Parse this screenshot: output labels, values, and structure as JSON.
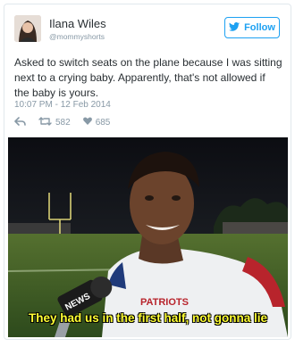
{
  "user": {
    "name": "Ilana Wiles",
    "handle": "@mommyshorts"
  },
  "follow_label": "Follow",
  "tweet": {
    "text": "Asked to switch seats on the plane because I was sitting next to a crying baby. Apparently, that's not allowed if the baby is yours.",
    "timestamp": "10:07 PM - 12 Feb 2014"
  },
  "actions": {
    "retweets": "582",
    "likes": "685"
  },
  "media": {
    "microphone_text": "NEWS",
    "jersey_text": "PATRIOTS",
    "subtitle": "They had us in the first half, not gonna lie"
  },
  "colors": {
    "brand_blue": "#1da1f2",
    "subtitle_yellow": "#ffff33"
  },
  "icons": [
    "bird-icon",
    "reply-icon",
    "retweet-icon",
    "heart-icon"
  ]
}
